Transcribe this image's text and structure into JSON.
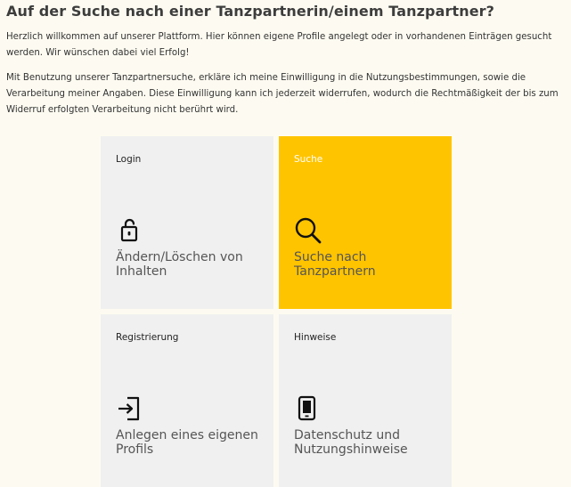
{
  "page": {
    "title": "Auf der Suche nach einer Tanzpartnerin/einem Tanzpartner?",
    "intro": "Herzlich willkommen auf unserer Plattform. Hier können eigene Profile angelegt oder in vorhandenen Einträgen gesucht werden. Wir wünschen dabei viel Erfolg!",
    "consent": "Mit Benutzung unserer Tanzpartnersuche, erkläre ich meine Einwilligung in die Nutzungsbestimmungen, sowie die Verarbeitung meiner Angaben. Diese Einwilligung kann ich jederzeit widerrufen, wodurch die Rechtmäßigkeit der bis zum Widerruf erfolgten Verarbeitung nicht berührt wird."
  },
  "tiles": [
    {
      "label": "Login",
      "text": "Ändern/Löschen von Inhalten",
      "icon": "unlock-icon",
      "active": false
    },
    {
      "label": "Suche",
      "text": "Suche nach Tanzpartnern",
      "icon": "search-icon",
      "active": true
    },
    {
      "label": "Registrierung",
      "text": "Anlegen eines eigenen Profils",
      "icon": "sign-in-icon",
      "active": false
    },
    {
      "label": "Hinweise",
      "text": "Datenschutz und Nutzungshinweise",
      "icon": "tablet-icon",
      "active": false
    }
  ],
  "colors": {
    "accent": "#ffc400",
    "tile_bg": "#f0f0f0",
    "page_bg": "#fdfbf1"
  }
}
